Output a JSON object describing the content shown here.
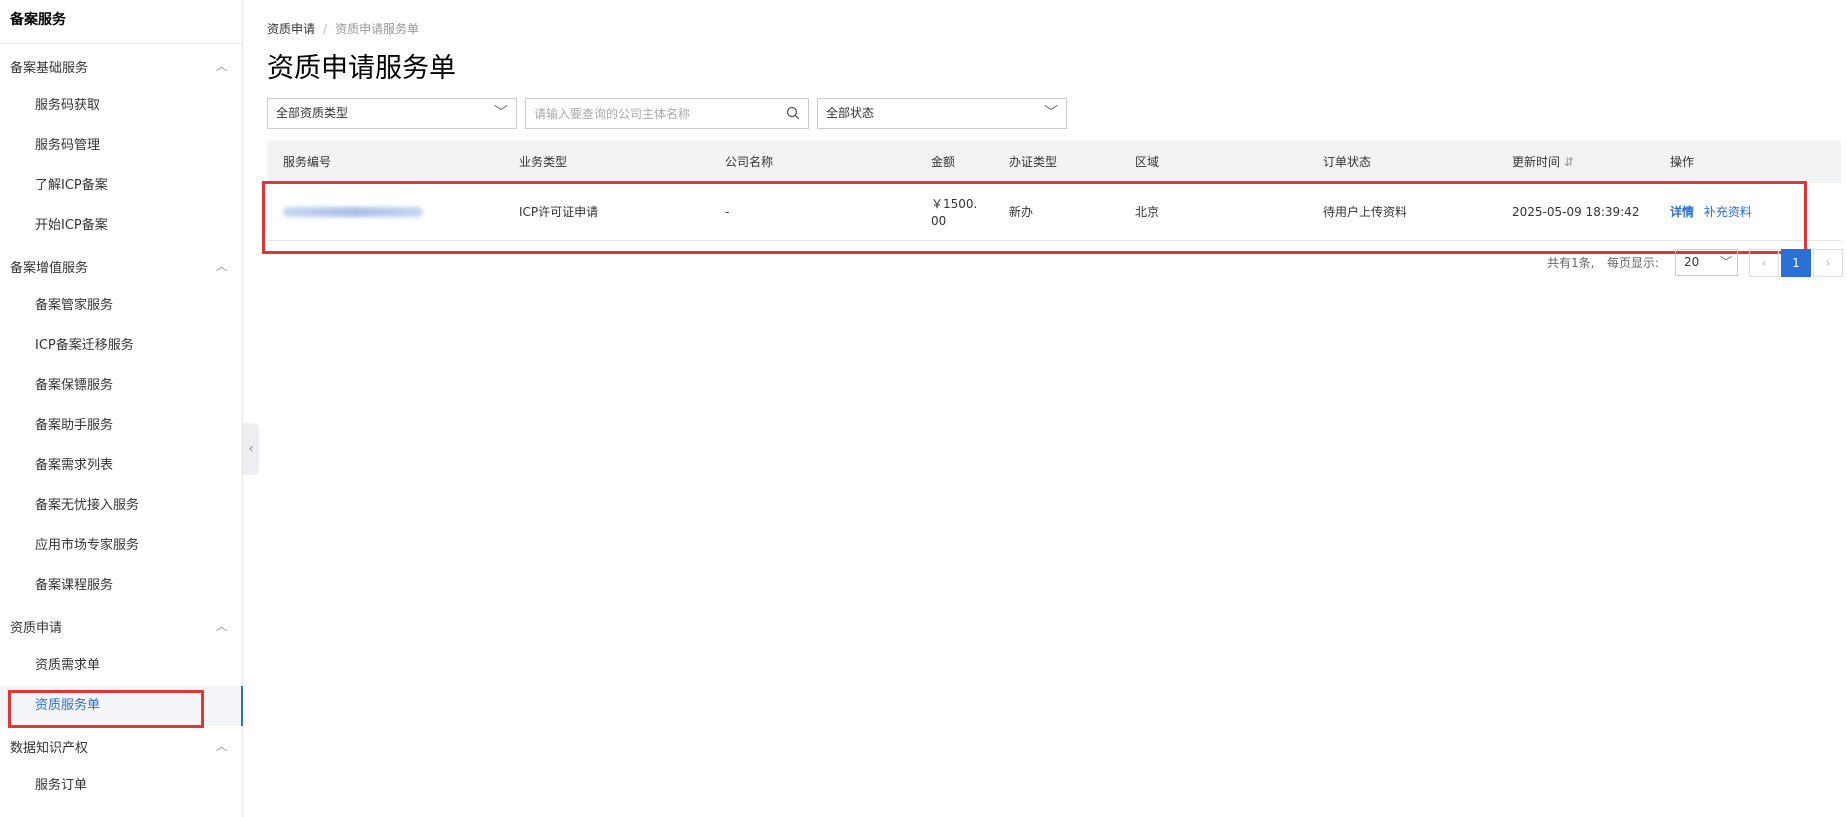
{
  "sidebar": {
    "title": "备案服务",
    "groups": [
      {
        "label": "备案基础服务",
        "items": [
          "服务码获取",
          "服务码管理",
          "了解ICP备案",
          "开始ICP备案"
        ]
      },
      {
        "label": "备案增值服务",
        "items": [
          "备案管家服务",
          "ICP备案迁移服务",
          "备案保镖服务",
          "备案助手服务",
          "备案需求列表",
          "备案无忧接入服务",
          "应用市场专家服务",
          "备案课程服务"
        ]
      },
      {
        "label": "资质申请",
        "items": [
          "资质需求单",
          "资质服务单"
        ]
      },
      {
        "label": "数据知识产权",
        "items": [
          "服务订单"
        ]
      }
    ],
    "chevron": "chevron-up-icon"
  },
  "breadcrumb": {
    "level1": "资质申请",
    "separator": "/",
    "level2": "资质申请服务单"
  },
  "page_title": "资质申请服务单",
  "filters": {
    "type_select": "全部资质类型",
    "search_placeholder": "请输入要查询的公司主体名称",
    "status_select": "全部状态"
  },
  "table": {
    "headers": {
      "service_no": "服务编号",
      "biz_type": "业务类型",
      "company": "公司名称",
      "amount": "金额",
      "cert_type": "办证类型",
      "region": "区域",
      "status": "订单状态",
      "updated": "更新时间",
      "ops": "操作"
    },
    "sort_icon": "sort-icon",
    "row": {
      "biz_type": "ICP许可证申请",
      "company": "-",
      "amount_line1": "￥1500.",
      "amount_line2": "00",
      "cert_type": "新办",
      "region": "北京",
      "status": "待用户上传资料",
      "updated": "2025-05-09 18:39:42",
      "op_detail": "详情",
      "op_supplement": "补充资料"
    }
  },
  "pager": {
    "total": "共有1条,",
    "per_page_label": "每页显示:",
    "per_page": "20",
    "current_page": "1",
    "prev": "‹",
    "next": "›"
  },
  "colors": {
    "accent": "#2a6fd6",
    "highlight": "#e03636"
  }
}
